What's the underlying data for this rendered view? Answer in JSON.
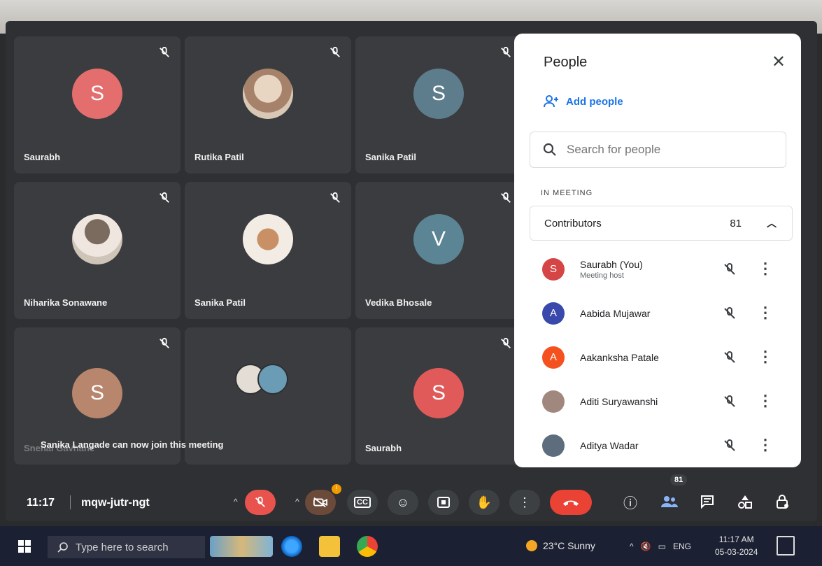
{
  "tiles": [
    {
      "name": "Saurabh",
      "initial": "S",
      "color": "#e46e6e"
    },
    {
      "name": "Rutika Patil",
      "initial": "",
      "color": ""
    },
    {
      "name": "Sanika Patil",
      "initial": "S",
      "color": "#5d7d8c"
    },
    {
      "name": "Niharika Sonawane",
      "initial": "",
      "color": ""
    },
    {
      "name": "Sanika Patil",
      "initial": "",
      "color": ""
    },
    {
      "name": "Vedika Bhosale",
      "initial": "V",
      "color": "#5b8494"
    },
    {
      "name": "Snehal Gavhane",
      "initial": "S",
      "color": "#b8856d"
    },
    {
      "name": "",
      "initial": "",
      "color": ""
    },
    {
      "name": "Saurabh",
      "initial": "S",
      "color": "#e05a5a"
    }
  ],
  "toast": "Sanika Langade can now join this meeting",
  "panel": {
    "title": "People",
    "add_people": "Add people",
    "search_placeholder": "Search for people",
    "section_label": "IN MEETING",
    "group_label": "Contributors",
    "group_count": "81",
    "people": [
      {
        "name": "Saurabh (You)",
        "sub": "Meeting host",
        "initial": "S",
        "color": "#d64545"
      },
      {
        "name": "Aabida Mujawar",
        "sub": "",
        "initial": "A",
        "color": "#3949ab"
      },
      {
        "name": "Aakanksha Patale",
        "sub": "",
        "initial": "A",
        "color": "#f4511e"
      },
      {
        "name": "Aditi Suryawanshi",
        "sub": "",
        "initial": "",
        "color": "#a1887f"
      },
      {
        "name": "Aditya Wadar",
        "sub": "",
        "initial": "",
        "color": "#5d6d7e"
      }
    ]
  },
  "controls": {
    "time": "11:17",
    "meeting_code": "mqw-jutr-ngt",
    "people_count": "81",
    "video_badge": "!"
  },
  "taskbar": {
    "search_placeholder": "Type here to search",
    "weather": "23°C Sunny",
    "lang": "ENG",
    "time": "11:17 AM",
    "date": "05-03-2024"
  }
}
